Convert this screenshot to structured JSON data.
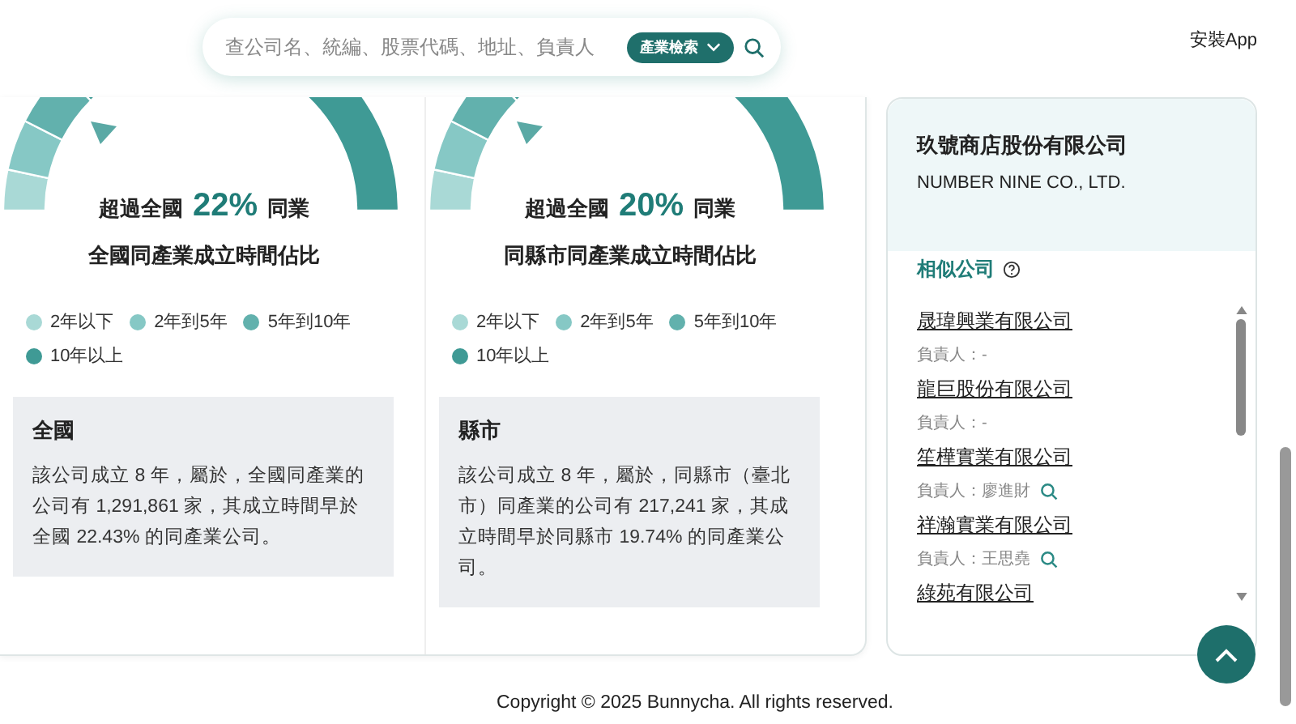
{
  "search": {
    "placeholder": "查公司名、統編、股票代碼、地址、負責人",
    "filter_button": "產業檢索"
  },
  "install_link": "安裝App",
  "comparisons": [
    {
      "headline_prefix": "超過全國",
      "percent": "22%",
      "headline_suffix": "同業",
      "title": "全國同產業成立時間佔比",
      "legend": [
        {
          "label": "2年以下",
          "color": "#a9d9d6"
        },
        {
          "label": "2年到5年",
          "color": "#86c8c5"
        },
        {
          "label": "5年到10年",
          "color": "#62b1ad"
        },
        {
          "label": "10年以上",
          "color": "#3f9a95"
        }
      ],
      "box_title": "全國",
      "box_text": "該公司成立 8 年，屬於，全國同產業的公司有 1,291,861 家，其成立時間早於全國 22.43% 的同產業公司。"
    },
    {
      "headline_prefix": "超過全國",
      "percent": "20%",
      "headline_suffix": "同業",
      "title": "同縣市同產業成立時間佔比",
      "legend": [
        {
          "label": "2年以下",
          "color": "#a9d9d6"
        },
        {
          "label": "2年到5年",
          "color": "#86c8c5"
        },
        {
          "label": "5年到10年",
          "color": "#62b1ad"
        },
        {
          "label": "10年以上",
          "color": "#3f9a95"
        }
      ],
      "box_title": "縣市",
      "box_text": "該公司成立 8 年，屬於，同縣市（臺北市）同產業的公司有 217,241 家，其成立時間早於同縣市 19.74% 的同產業公司。"
    }
  ],
  "company": {
    "name": "玖號商店股份有限公司",
    "english_name": "NUMBER NINE CO., LTD."
  },
  "similar": {
    "title": "相似公司",
    "items": [
      {
        "name": "晟瑋興業有限公司",
        "owner": "負責人：-",
        "searchable": false
      },
      {
        "name": "龍巨股份有限公司",
        "owner": "負責人：-",
        "searchable": false
      },
      {
        "name": "笙樺實業有限公司",
        "owner": "負責人：廖進財",
        "searchable": true
      },
      {
        "name": "祥瀚實業有限公司",
        "owner": "負責人：王思堯",
        "searchable": true
      },
      {
        "name": "綠苑有限公司"
      }
    ]
  },
  "footer": "Copyright © 2025 Bunnycha. All rights reserved."
}
